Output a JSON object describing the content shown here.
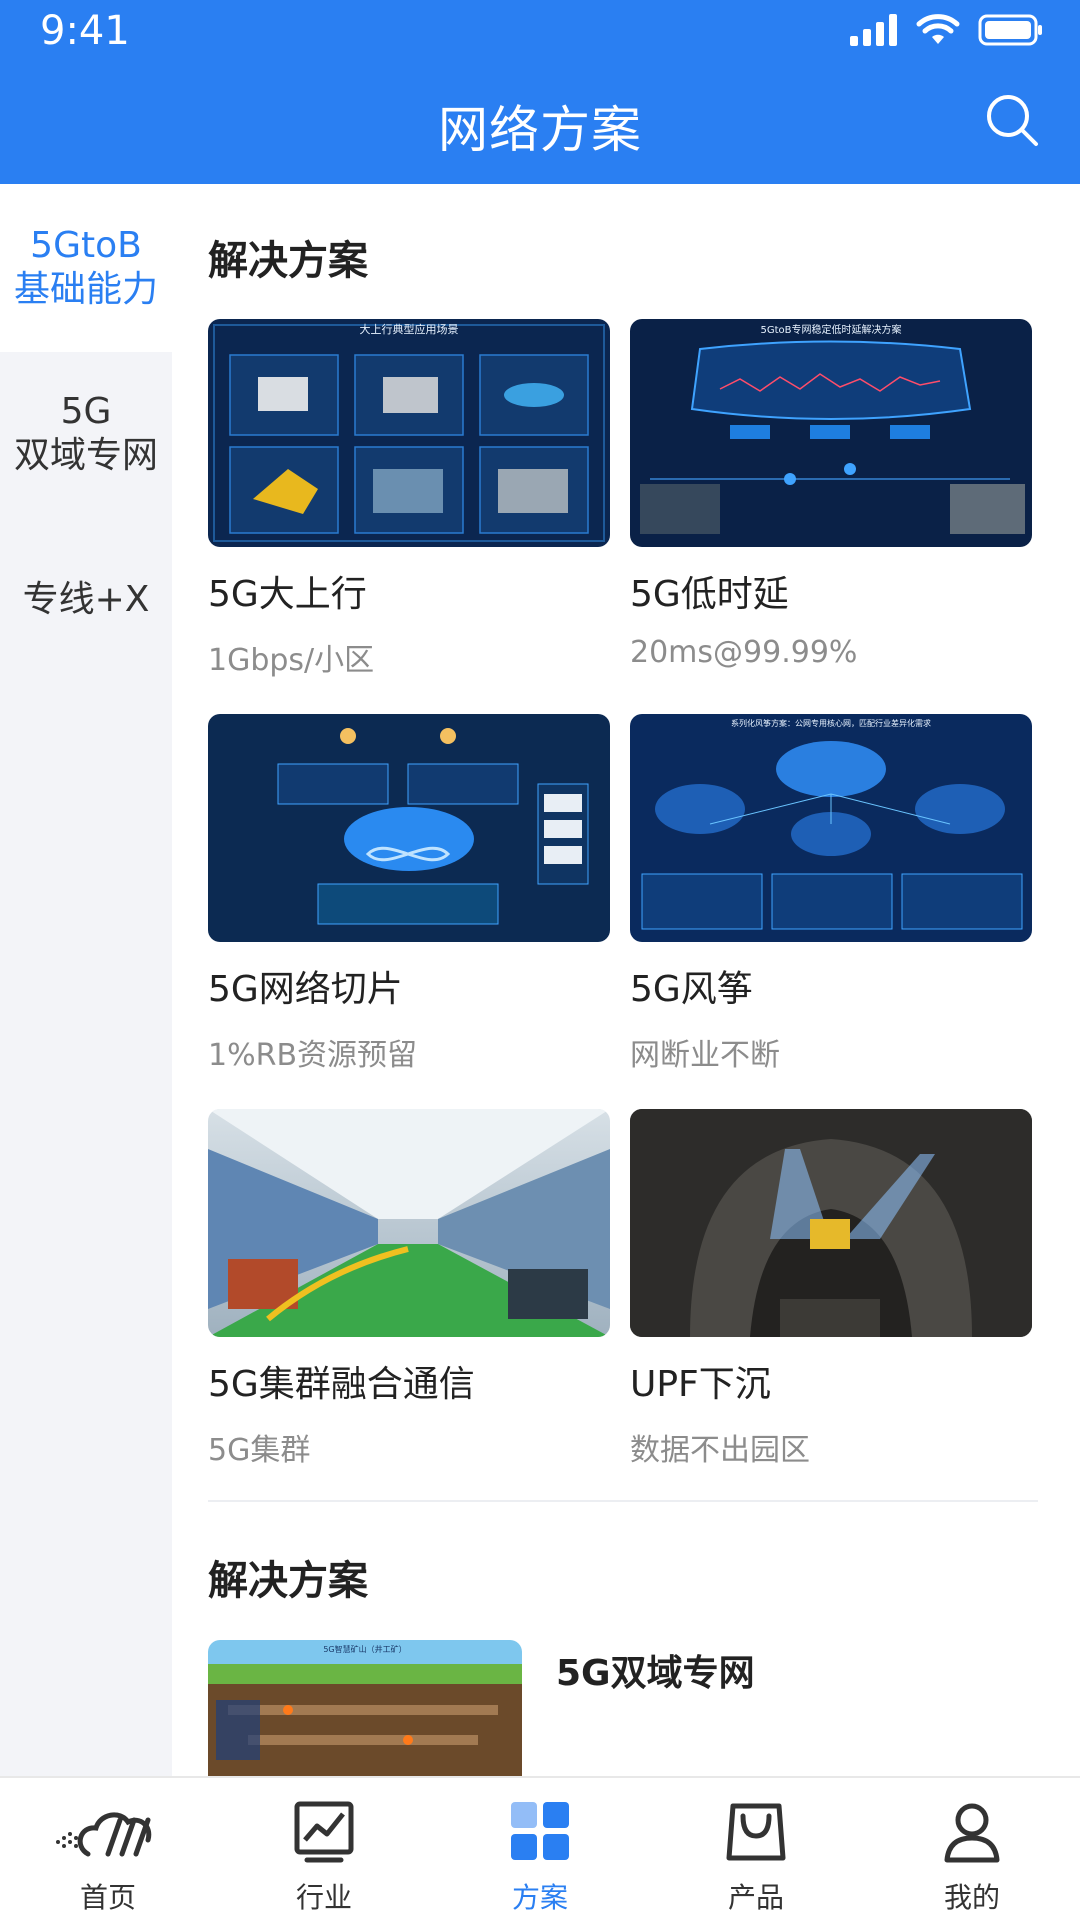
{
  "status": {
    "time": "9:41"
  },
  "header": {
    "title": "网络方案"
  },
  "sidebar": {
    "items": [
      {
        "label_line1": "5GtoB",
        "label_line2": "基础能力"
      },
      {
        "label_line1": "5G",
        "label_line2": "双域专网"
      },
      {
        "label_line1": "专线+X",
        "label_line2": ""
      }
    ]
  },
  "sections": [
    {
      "title": "解决方案",
      "cards": [
        {
          "title": "5G大上行",
          "subtitle": "1Gbps/小区",
          "image_caption": "大上行典型应用场景"
        },
        {
          "title": "5G低时延",
          "subtitle": "20ms@99.99%",
          "image_caption": "5GtoB专网稳定低时延解决方案"
        },
        {
          "title": "5G网络切片",
          "subtitle": "1%RB资源预留",
          "image_caption": ""
        },
        {
          "title": "5G风筝",
          "subtitle": "网断业不断",
          "image_caption": "系列化风筝方案：公网专用核心网，匹配行业差异化需求"
        },
        {
          "title": "5G集群融合通信",
          "subtitle": "5G集群",
          "image_caption": ""
        },
        {
          "title": "UPF下沉",
          "subtitle": "数据不出园区",
          "image_caption": ""
        }
      ]
    },
    {
      "title": "解决方案",
      "cards": [
        {
          "title": "5G双域专网",
          "image_caption": "5G智慧矿山（井工矿）"
        }
      ]
    }
  ],
  "bottom_nav": {
    "items": [
      {
        "label": "首页",
        "icon": "home-logo-icon"
      },
      {
        "label": "行业",
        "icon": "chart-icon"
      },
      {
        "label": "方案",
        "icon": "grid-icon",
        "active": true
      },
      {
        "label": "产品",
        "icon": "bag-icon"
      },
      {
        "label": "我的",
        "icon": "user-icon"
      }
    ]
  },
  "colors": {
    "accent": "#2a7ff2",
    "sidebar_bg": "#f3f4f8",
    "subtitle": "#8c8c8c"
  }
}
